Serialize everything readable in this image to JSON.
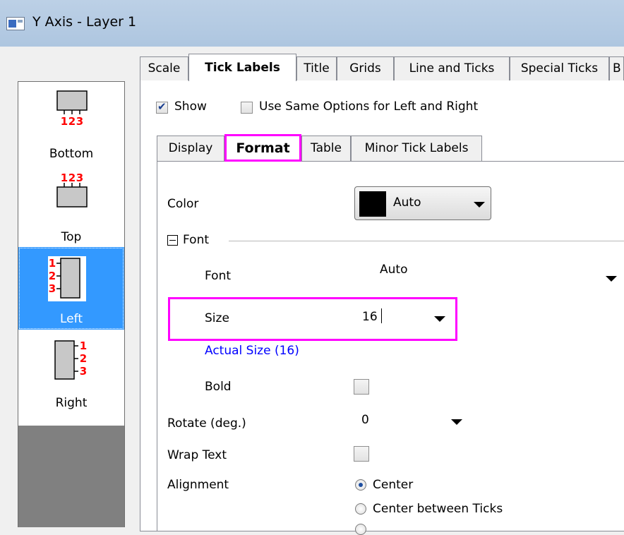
{
  "window": {
    "title": "Y Axis - Layer 1"
  },
  "sidebar": {
    "items": [
      {
        "label": "Bottom",
        "icon": "bottom-axis-icon",
        "selected": false
      },
      {
        "label": "Top",
        "icon": "top-axis-icon",
        "selected": false
      },
      {
        "label": "Left",
        "icon": "left-axis-icon",
        "selected": true
      },
      {
        "label": "Right",
        "icon": "right-axis-icon",
        "selected": false
      }
    ],
    "icon_tick_text": [
      "1",
      "2",
      "3"
    ]
  },
  "tabs": [
    "Scale",
    "Tick Labels",
    "Title",
    "Grids",
    "Line and Ticks",
    "Special Ticks",
    "B"
  ],
  "active_tab": "Tick Labels",
  "show": {
    "label": "Show",
    "checked": true
  },
  "same_options": {
    "label": "Use Same Options for Left and Right",
    "checked": false
  },
  "subtabs": [
    "Display",
    "Format",
    "Table",
    "Minor Tick Labels"
  ],
  "active_subtab": "Format",
  "format": {
    "color": {
      "label": "Color",
      "value": "Auto",
      "swatch": "#000000"
    },
    "font_group": {
      "label": "Font",
      "expanded": true
    },
    "font": {
      "label": "Font",
      "value": "Auto"
    },
    "size": {
      "label": "Size",
      "value": "16"
    },
    "actual_size": "Actual Size (16)",
    "bold": {
      "label": "Bold",
      "checked": false
    },
    "rotate": {
      "label": "Rotate (deg.)",
      "value": "0"
    },
    "wrap_text": {
      "label": "Wrap Text",
      "checked": false
    },
    "alignment": {
      "label": "Alignment",
      "options": [
        "Center",
        "Center between Ticks"
      ],
      "selected": "Center"
    }
  },
  "colors": {
    "highlight": "#ff00ff",
    "selection": "#3399ff",
    "tick_numbers": "#ff0000",
    "link": "#0000ff"
  }
}
